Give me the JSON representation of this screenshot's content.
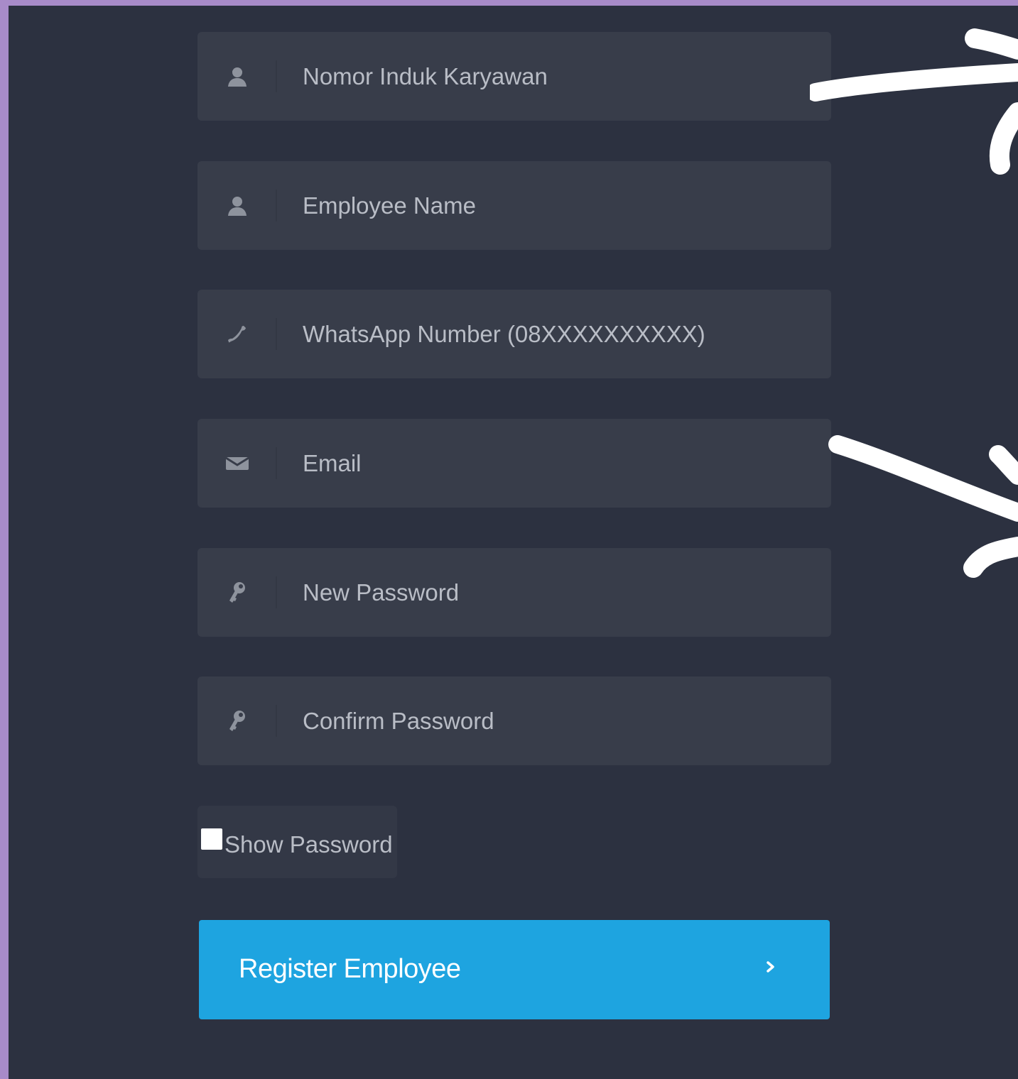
{
  "form": {
    "fields": [
      {
        "placeholder": "Nomor Induk Karyawan",
        "icon": "user-icon"
      },
      {
        "placeholder": "Employee Name",
        "icon": "user-icon"
      },
      {
        "placeholder": "WhatsApp Number (08XXXXXXXXXX)",
        "icon": "phone-icon"
      },
      {
        "placeholder": "Email",
        "icon": "envelope-icon"
      },
      {
        "placeholder": "New Password",
        "icon": "key-icon"
      },
      {
        "placeholder": "Confirm Password",
        "icon": "key-icon"
      }
    ],
    "show_password_label": "Show Password",
    "show_password_checked": false,
    "submit_label": "Register Employee",
    "submit_icon": "chevron-right-icon"
  },
  "colors": {
    "background": "#2c3140",
    "field_background": "#383d4a",
    "accent": "#1ea4e0",
    "frame": "#a88bc9",
    "annotation": "#ffffff"
  }
}
